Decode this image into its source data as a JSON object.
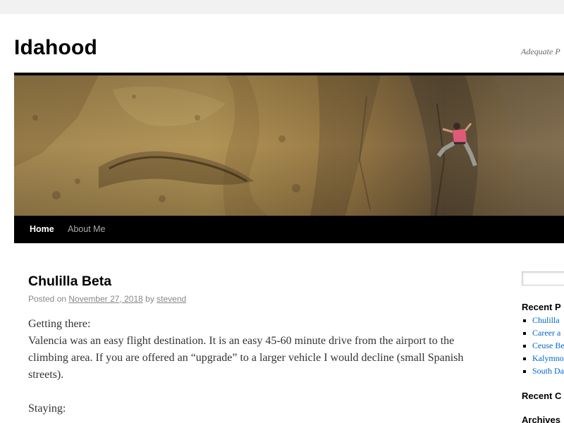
{
  "site": {
    "title": "Idahood",
    "description": "Adequate P"
  },
  "nav": {
    "items": [
      {
        "label": "Home",
        "current": true
      },
      {
        "label": "About Me",
        "current": false
      }
    ]
  },
  "post": {
    "title": "Chulilla Beta",
    "meta": {
      "posted_on": "Posted on",
      "date": "November 27, 2018",
      "by": "by",
      "author": "stevend"
    },
    "paragraphs": [
      "Getting there:\nValencia was an easy flight destination. It is an easy 45-60 minute drive from the airport to the climbing area. If you are offered an “upgrade” to a larger vehicle I would decline (small Spanish streets).",
      "Staying:"
    ]
  },
  "sidebar": {
    "search_value": "",
    "recent_posts_title": "Recent P",
    "recent_posts": [
      "Chulilla",
      "Career a",
      "Ceuse Be",
      "Kalymno",
      "South Da"
    ],
    "recent_comments_title": "Recent C",
    "archives_title": "Archives"
  },
  "colors": {
    "nav_background": "#000000",
    "link": "#0066cc",
    "meta_text": "#888888"
  }
}
